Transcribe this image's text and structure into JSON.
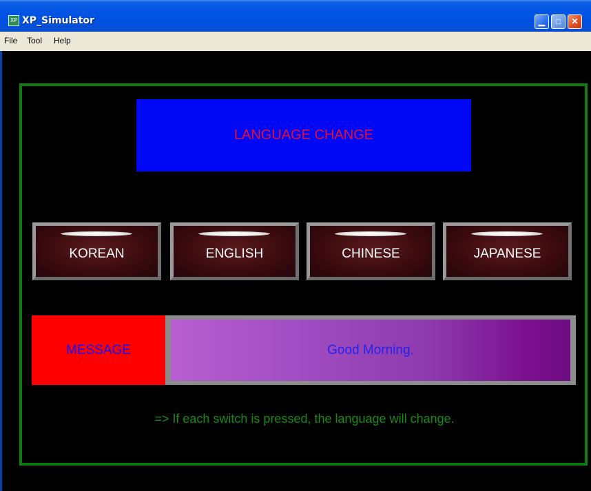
{
  "window": {
    "title": "XP_Simulator",
    "app_icon_text": "XP"
  },
  "menu": [
    {
      "label": "File"
    },
    {
      "label": "Tool"
    },
    {
      "label": "Help"
    }
  ],
  "banner": {
    "text": "LANGUAGE CHANGE"
  },
  "switches": [
    {
      "label": "KOREAN"
    },
    {
      "label": "ENGLISH"
    },
    {
      "label": "CHINESE"
    },
    {
      "label": "JAPANESE"
    }
  ],
  "message": {
    "label": "MESSAGE",
    "value": "Good Morning."
  },
  "hint": "=> If each switch is pressed,  the language will change.",
  "colors": {
    "background": "#000000",
    "frame": "#0f7a12",
    "banner_bg": "#0008f6",
    "banner_text": "#e0103c",
    "message_label_bg": "#ff0000",
    "message_text": "#2222ee",
    "hint_text": "#1a8a1a"
  }
}
